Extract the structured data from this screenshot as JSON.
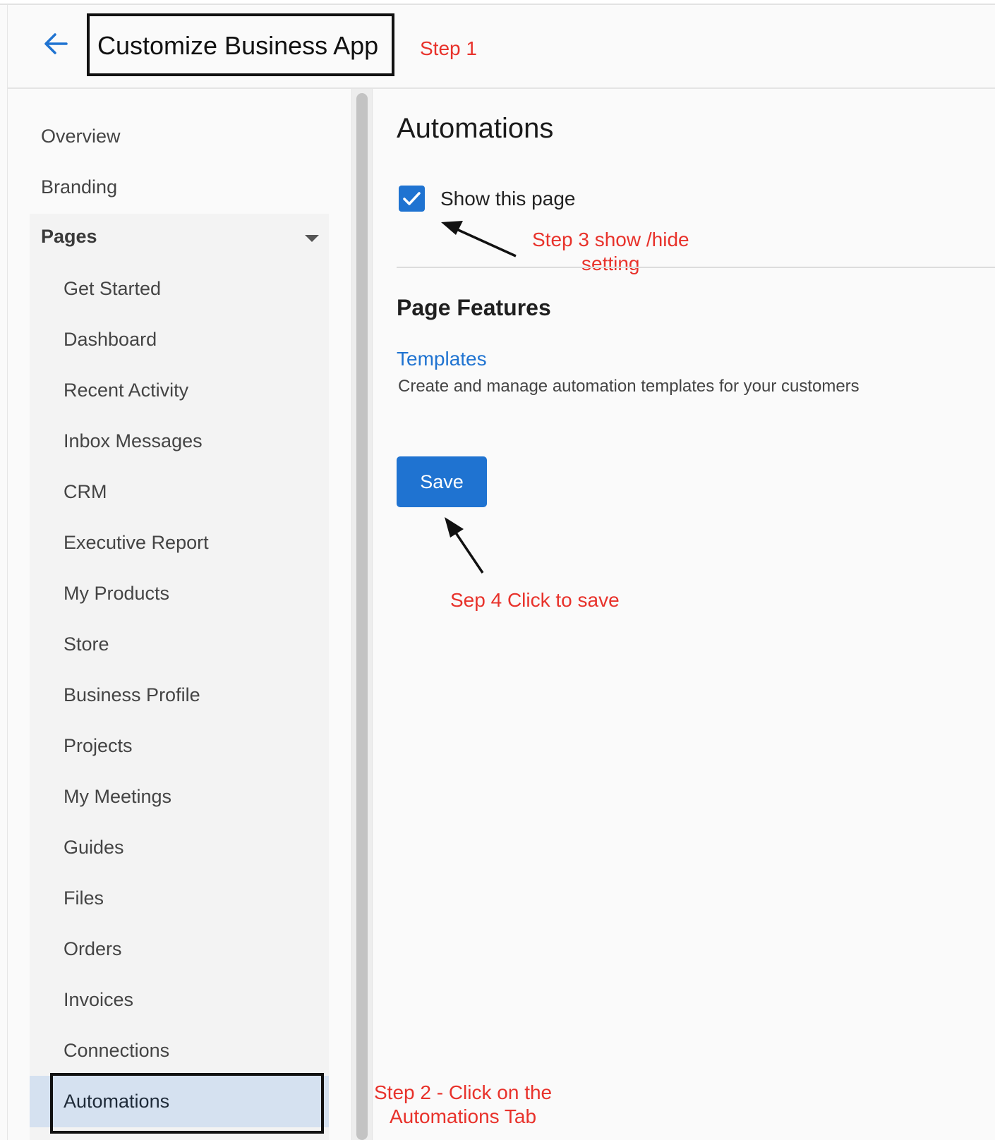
{
  "header": {
    "title": "Customize Business App"
  },
  "annotations": {
    "step1": "Step 1",
    "step2_line1": "Step 2 - Click on the",
    "step2_line2": "Automations Tab",
    "step3_line1": "Step 3 show /hide",
    "step3_line2": "setting",
    "step4": "Sep 4 Click to save"
  },
  "sidebar": {
    "overview": "Overview",
    "branding": "Branding",
    "pages_label": "Pages",
    "pages": [
      "Get Started",
      "Dashboard",
      "Recent Activity",
      "Inbox Messages",
      "CRM",
      "Executive Report",
      "My Products",
      "Store",
      "Business Profile",
      "Projects",
      "My Meetings",
      "Guides",
      "Files",
      "Orders",
      "Invoices",
      "Connections",
      "Automations"
    ],
    "active_page": "Automations"
  },
  "main": {
    "title": "Automations",
    "show_page_label": "Show this page",
    "show_page_checked": true,
    "features_title": "Page Features",
    "templates_link": "Templates",
    "templates_desc": "Create and manage automation templates for your customers",
    "save_label": "Save"
  },
  "colors": {
    "accent": "#1f73d1",
    "annotation": "#e8322b",
    "active_bg": "#d5e1f0"
  }
}
